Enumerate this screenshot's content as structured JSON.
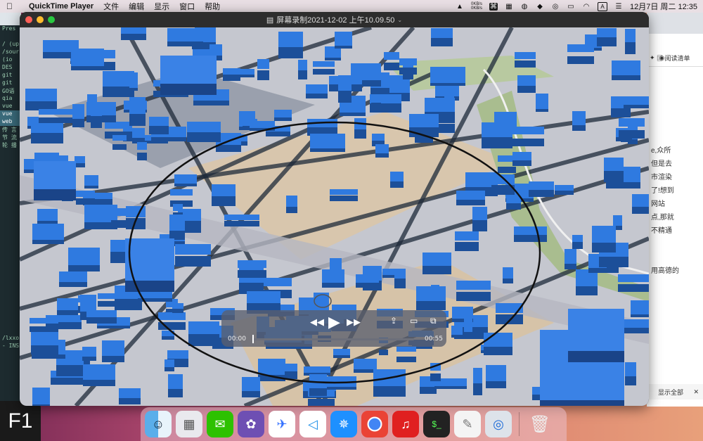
{
  "menubar": {
    "app_name": "QuickTime Player",
    "menus": [
      "文件",
      "编辑",
      "显示",
      "窗口",
      "帮助"
    ],
    "net_up": "0KB/s",
    "net_down": "0KB/s",
    "clock": "12月7日 周二 12:35"
  },
  "terminal": {
    "lines": [
      "Pres",
      "",
      "/ (up",
      "/sour",
      "(io",
      "DES",
      "git",
      "git",
      "GO语",
      "qia",
      "vue",
      "vue",
      "web",
      "传 言",
      "节 流",
      "轮 播",
      "",
      "",
      "",
      "",
      "",
      "",
      "",
      "",
      "",
      "",
      "",
      "",
      "",
      "",
      "",
      "",
      "",
      "",
      "",
      "",
      "",
      "",
      "",
      "",
      "/lxxo",
      "- INSE"
    ],
    "f1_label": "F1"
  },
  "window": {
    "title": "屏幕录制2021-12-02 上午10.09.50",
    "traffic_colors": [
      "#ff5f57",
      "#febc2e",
      "#28c840"
    ]
  },
  "player": {
    "current_time": "00:00",
    "duration": "00:55",
    "progress": 0
  },
  "browser": {
    "reading_list": "阅读清单",
    "text_lines": [
      "e,众所",
      "但是去",
      "市渲染",
      "了!想到",
      "网站",
      "点,那就",
      "不精通",
      "",
      "",
      "用高德的"
    ],
    "show_all": "显示全部",
    "close": "✕"
  },
  "dock": {
    "apps": [
      "finder-icon",
      "launchpad-icon",
      "wechat-icon",
      "github-desktop-icon",
      "feishu-icon",
      "vscode-icon",
      "safari-icon",
      "chrome-icon",
      "netease-music-icon",
      "terminal-icon",
      "textedit-icon",
      "quicktime-icon",
      "trash-icon"
    ]
  },
  "colors": {
    "accent_building": "#2f7ae0",
    "map_ground": "#c9cbd3",
    "road": "#1e2a3a"
  }
}
